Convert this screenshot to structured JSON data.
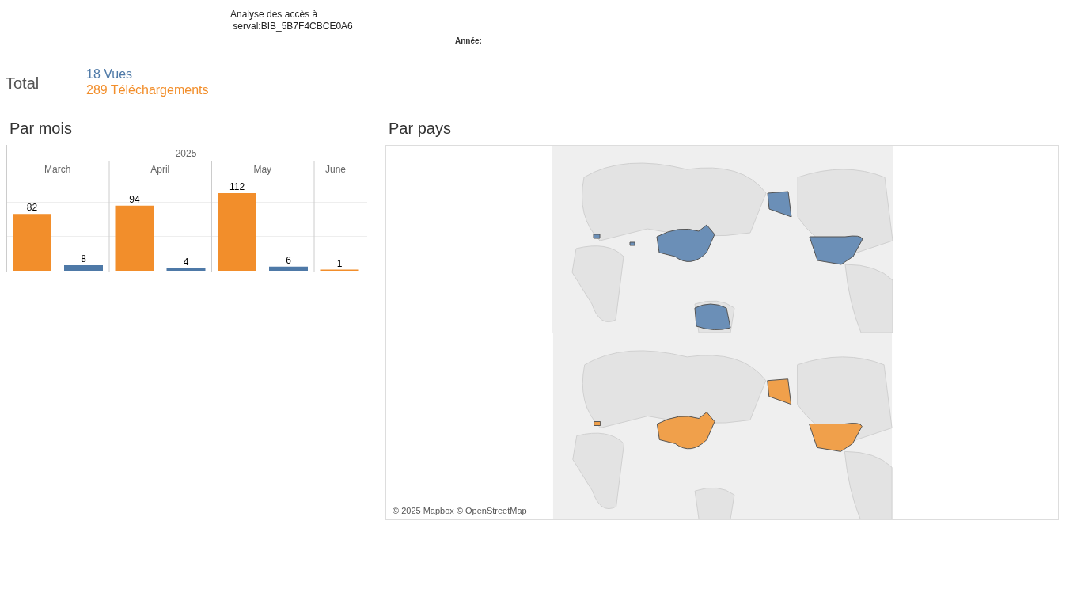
{
  "title": "Analyse des accès à\n serval:BIB_5B7F4CBCE0A6",
  "filter_label": "Année:",
  "total": {
    "label": "Total",
    "views": "18 Vues",
    "downloads": "289 Téléchargements"
  },
  "by_month": {
    "title": "Par mois",
    "year": "2025",
    "chart_data": {
      "type": "bar",
      "categories": [
        "March",
        "April",
        "May",
        "June"
      ],
      "series": [
        {
          "color": "#f28e2b",
          "values": [
            82,
            94,
            112,
            1
          ]
        },
        {
          "color": "#4e79a7",
          "values": [
            8,
            4,
            6,
            null
          ]
        }
      ],
      "data_labels": true
    }
  },
  "by_country": {
    "title": "Par pays",
    "maps": [
      {
        "kind": "views"
      },
      {
        "kind": "downloads"
      }
    ],
    "attribution": "© 2025 Mapbox © OpenStreetMap"
  }
}
